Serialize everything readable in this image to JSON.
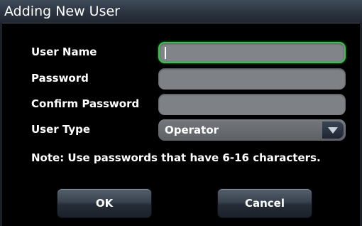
{
  "dialog": {
    "title": "Adding New User"
  },
  "form": {
    "user_name_label": "User Name",
    "user_name_value": "",
    "password_label": "Password",
    "password_value": "",
    "confirm_password_label": "Confirm Password",
    "confirm_password_value": "",
    "user_type_label": "User Type",
    "user_type_value": "Operator"
  },
  "note": "Note: Use passwords that have 6-16 characters.",
  "buttons": {
    "ok_label": "OK",
    "cancel_label": "Cancel"
  },
  "colors": {
    "focus_border": "#39c24d",
    "field_background": "#7e8186",
    "title_bar": "#2c3440"
  },
  "icons": {
    "dropdown": "chevron-down-icon"
  }
}
